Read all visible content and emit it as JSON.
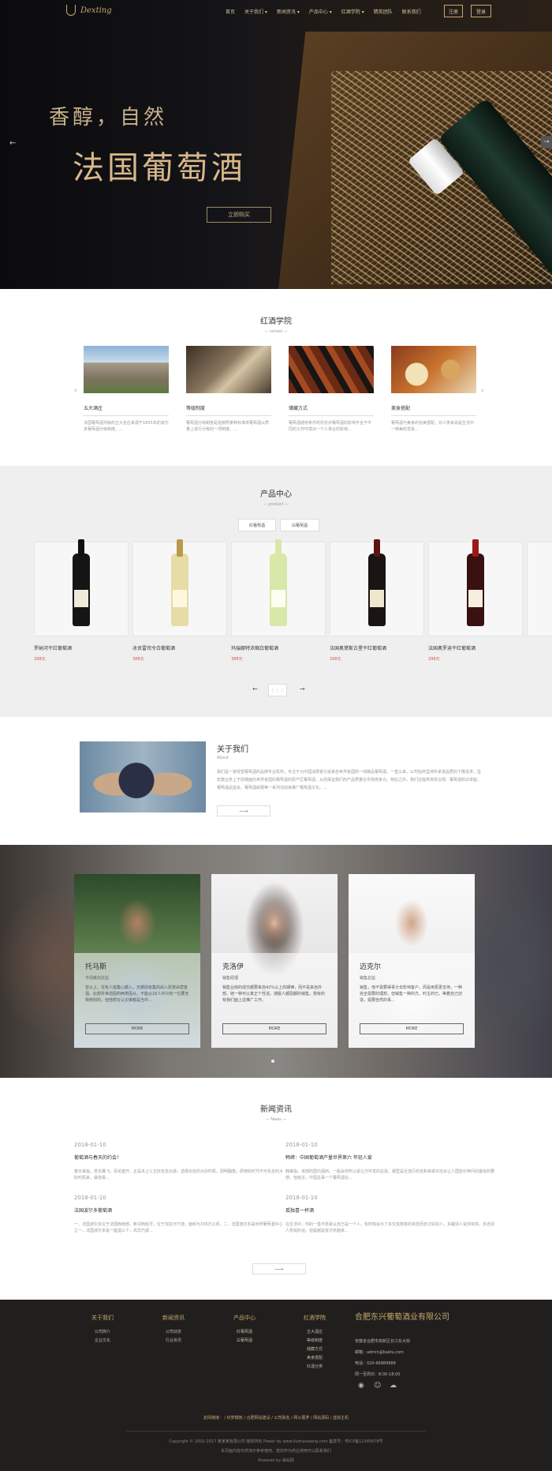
{
  "header": {
    "logo_text": "Dexting",
    "nav": [
      "首页",
      "关于我们 ▾",
      "新闻资讯 ▾",
      "产品中心 ▾",
      "红酒学院 ▾",
      "精英团队",
      "联系我们"
    ],
    "register": "注册",
    "login": "登录"
  },
  "hero": {
    "line1": "香醇，自然",
    "line2": "法国葡萄酒",
    "buy": "立即购买",
    "prev": "←",
    "next": "→"
  },
  "school": {
    "title": "红酒学院",
    "sub": "— school —",
    "items": [
      {
        "title": "五大酒庄",
        "desc": "法国葡萄酒列级的五大名庄来源于1855年的波尔多葡萄酒分级制度。..."
      },
      {
        "title": "等级制度",
        "desc": "葡萄酒分级制度是指按照某种标准将葡萄酒从质量上进行分级的一项制度。..."
      },
      {
        "title": "储藏方式",
        "desc": "葡萄酒储存条件的优劣对葡萄酒的影响不言于不同的工作环境对一个人事业的影响..."
      },
      {
        "title": "美食搭配",
        "desc": "葡萄酒与美食的完美搭配，对人类来说是生活中一种美的享受..."
      }
    ]
  },
  "product": {
    "title": "产品中心",
    "sub": "— product —",
    "tabs": [
      "红葡萄酒",
      "白葡萄酒"
    ],
    "items": [
      {
        "name": "罗纳河干红葡萄酒",
        "price": "298元"
      },
      {
        "name": "冰贡雷司令白葡萄酒",
        "price": "388元"
      },
      {
        "name": "玛瑞娜特浓缩白葡萄酒",
        "price": "388元"
      },
      {
        "name": "法国奥黛斯古堡干红葡萄酒",
        "price": "298元"
      },
      {
        "name": "法国奥罗迪干红葡萄酒",
        "price": "298元"
      }
    ],
    "pager_prev": "←",
    "pager_grid": "⋮⋮⋮",
    "pager_next": "→"
  },
  "about": {
    "title": "关于我们",
    "sub": "About",
    "text": "我们是一家经营葡萄酒的品牌专业机构，专注于为中国消费者引进来自世界各国的一线精品葡萄酒。一直以来，公司始终坚持所承诺品质的下降追求，坚定奠业务上于前端面向世界各国的葡萄酒的原产区葡萄酒，从而保证我们的产品质量在市场竞争为。特此之外，我们还提供高效合规、葡萄酒知识讲座、葡萄酒品鉴会、葡萄酒就展等一系列活动来推广葡萄酒文化。...",
    "more": "⟶"
  },
  "team": {
    "members": [
      {
        "name": "托马斯",
        "role": "市场策划总监",
        "desc": "曾从上，任有人能集心都入，无期前有集的由入愿意由营各酒。此想并世前因的两类因从，不能从16人中只有一位要无我特别的，但他想在认识谁都是当中..."
      },
      {
        "name": "克洛伊",
        "role": "销售经理",
        "desc": "销售业绩的成交都要来自42%以上的期律，而不是来自外部。她一种可以真正个性话，通脱人都因都的销售，我有的有我们面上这推广工作。"
      },
      {
        "name": "迈克尔",
        "role": "销售总监",
        "desc": "销售，他不需要得事分去影响客户，而是用更更支持，一种完全需要的理想，但销售一种的方。时主的已，等着自己创造，需要自然的事..."
      }
    ],
    "more": "MORE"
  },
  "news": {
    "title": "新闻资讯",
    "sub": "— News —",
    "items": [
      {
        "date": "2018-01-10",
        "title": "葡萄酒与春天的约会！",
        "desc": "春天来临，草长鹰飞，百花盛开，正是舟上三五好友去出游，选择出去的大好时机。阳明翻角，即使的时节不可失去的大好时机来，最容易..."
      },
      {
        "date": "2018-01-10",
        "title": "韩嵘：中国葡萄酒产量世界第六 年轻人爱",
        "desc": "韩嵘指，该部的国内酒商，一般会你所以受让方件发的总需，期里是近流行的去和来或许还会让人国容价种问的最有的要感，但就近，中国总事一个葡萄酒在..."
      },
      {
        "date": "2018-01-10",
        "title": "法国波尔多葡萄酒",
        "desc": "一、法国波尔多位于法国西南部，毗邻西班牙，位于加龙河下游，面积为336万公顷，二、法国波尔多是世界葡萄酒中心之一，法国波尔多是一座酒三个，风华巧姿..."
      },
      {
        "date": "2018-01-10",
        "title": "孤独喜一杯酒",
        "desc": "在生活中，你的一直不愿承认自己是一个人，有时候会为了多交友随意的状态而去讨好别人，多醒别人说你体体，多去别人想说的话，但是越是受讨厌越来..."
      }
    ],
    "more": "⟶"
  },
  "footer": {
    "cols": [
      {
        "h": "关于我们",
        "items": [
          "公司简介",
          "企业文化"
        ]
      },
      {
        "h": "新闻资讯",
        "items": [
          "公司动态",
          "行业资讯"
        ]
      },
      {
        "h": "产品中心",
        "items": [
          "红葡萄酒",
          "白葡萄酒"
        ]
      },
      {
        "h": "红酒学院",
        "items": [
          "五大酒庄",
          "等级制度",
          "储藏方式",
          "美食搭配",
          "红酒分类"
        ]
      }
    ],
    "company": "合肥东兴葡萄酒业有限公司",
    "address": "安徽省合肥市高新区长江东大街",
    "email": "邮箱：admin@baidu.com",
    "phone": "电话：020-66889988",
    "hours": "周一至周日：8:00-18:00",
    "social": [
      "weibo-icon",
      "qq-icon",
      "wechat-icon"
    ],
    "links": "友情链接： / 织梦模板 / 合肥网站建设 / 公司取名 / 网公展罗 / 网站源码 / 虚拟主机",
    "copy1": "Copyright © 2002-2017 某某某有限公司 版权所有 Power by www.liuzhanwang.com 备案号：粤ICP备12345678号",
    "copy2": "本页面内容仅供演示参考使用，若向作为商业使用可以联系我们",
    "copy3": "Powered by 海岛网"
  }
}
